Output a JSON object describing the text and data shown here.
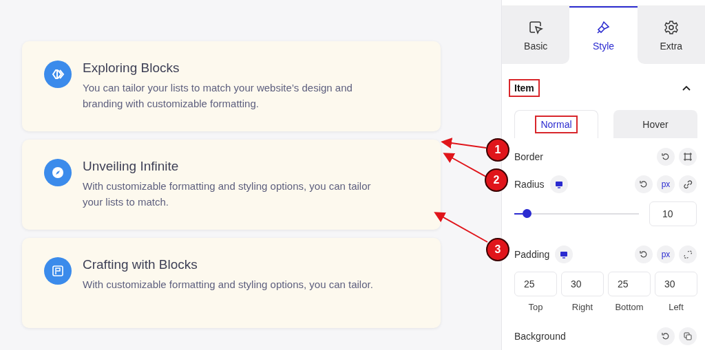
{
  "cards": [
    {
      "kind": "chevrons",
      "title": "Exploring Blocks",
      "text": "You can tailor your lists to match your website’s design and branding with customizable formatting."
    },
    {
      "kind": "compass",
      "title": "Unveiling Infinite",
      "text": "With customizable formatting and styling options, you can tailor your lists to match."
    },
    {
      "kind": "frame",
      "title": "Crafting with Blocks",
      "text": "With customizable formatting and styling options, you can tailor."
    }
  ],
  "panel": {
    "tabs": [
      {
        "kind": "cursor",
        "label": "Basic",
        "selected": false
      },
      {
        "kind": "brush",
        "label": "Style",
        "selected": true
      },
      {
        "kind": "gear",
        "label": "Extra",
        "selected": false
      }
    ],
    "section": {
      "title": "Item",
      "expanded": true,
      "highlighted": true
    },
    "state_tabs": [
      {
        "label": "Normal",
        "selected": true,
        "highlighted": true
      },
      {
        "label": "Hover",
        "selected": false,
        "highlighted": false
      }
    ],
    "border": {
      "label": "Border"
    },
    "radius": {
      "label": "Radius",
      "unit": "px",
      "level": 0.1,
      "value": "10"
    },
    "padding": {
      "label": "Padding",
      "unit": "px",
      "fields": [
        {
          "value": "25",
          "label": "Top"
        },
        {
          "value": "30",
          "label": "Right"
        },
        {
          "value": "25",
          "label": "Bottom"
        },
        {
          "value": "30",
          "label": "Left"
        }
      ]
    },
    "background": {
      "label": "Background"
    }
  },
  "annotations": [
    {
      "number": "1"
    },
    {
      "number": "2"
    },
    {
      "number": "3"
    }
  ]
}
